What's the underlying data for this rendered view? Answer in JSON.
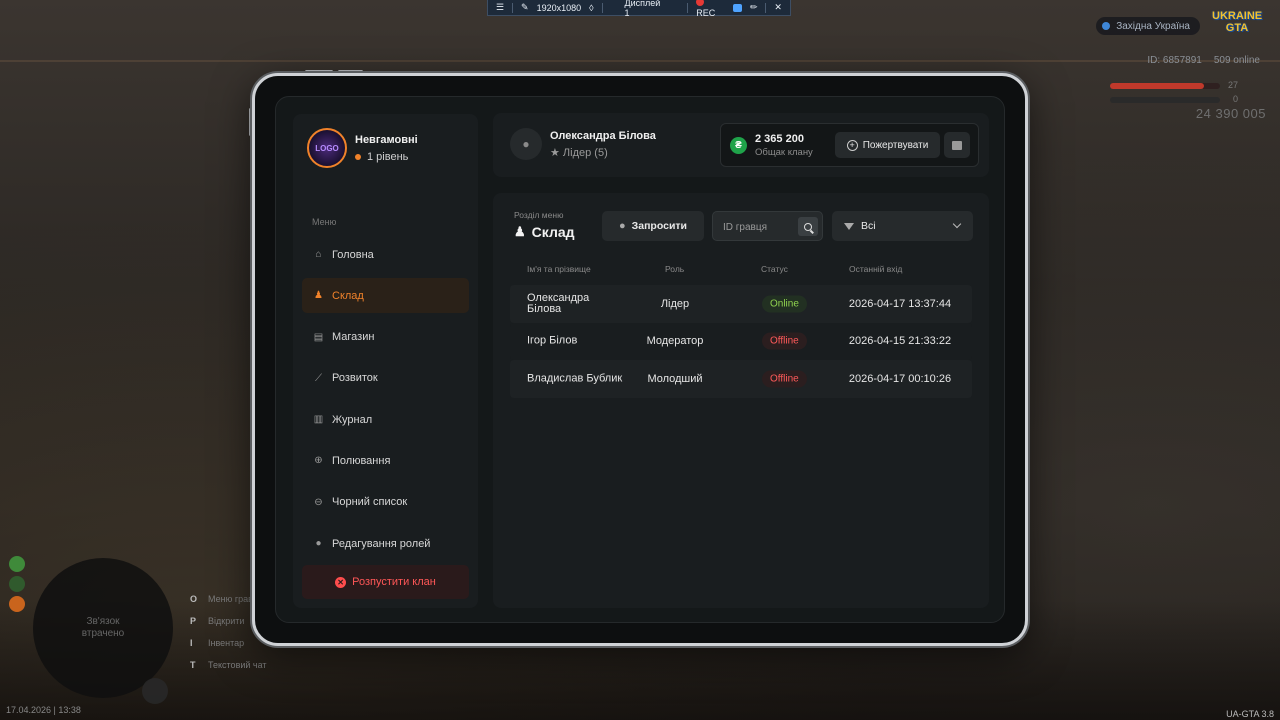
{
  "rec_bar": {
    "resolution": "1920x1080",
    "display": "Дисплей 1",
    "rec": "REC"
  },
  "hud": {
    "region": "Західна Україна",
    "logo": "UKRAINE GTA",
    "player_id": "ID: 6857891",
    "online": "509 online",
    "hp": "27",
    "armor": "0",
    "money": "24 390 005",
    "datetime": "17.04.2026 | 13:38",
    "version": "UA-GTA 3.8",
    "minimap_text": "Зв'язок втрачено",
    "hints": [
      {
        "key": "O",
        "label": "Меню гравця"
      },
      {
        "key": "P",
        "label": "Відкрити"
      },
      {
        "key": "I",
        "label": "Інвентар"
      },
      {
        "key": "T",
        "label": "Текстовий чат"
      }
    ]
  },
  "sidebar": {
    "clan_name": "Невгамовні",
    "clan_level": "1 рівень",
    "avatar_text": "LOGO",
    "menu_label": "Меню",
    "items": [
      {
        "label": "Головна",
        "icon": "home-icon",
        "glyph": "⌂"
      },
      {
        "label": "Склад",
        "icon": "people-icon",
        "glyph": "👥"
      },
      {
        "label": "Магазин",
        "icon": "shop-icon",
        "glyph": "▤"
      },
      {
        "label": "Розвиток",
        "icon": "chart-icon",
        "glyph": "📈"
      },
      {
        "label": "Журнал",
        "icon": "book-icon",
        "glyph": "▥"
      },
      {
        "label": "Полювання",
        "icon": "crosshair-icon",
        "glyph": "⊕"
      },
      {
        "label": "Чорний список",
        "icon": "block-icon",
        "glyph": "⊖"
      },
      {
        "label": "Редагування ролей",
        "icon": "user-edit-icon",
        "glyph": "👤"
      }
    ],
    "disband_label": "Розпустити клан"
  },
  "header": {
    "user_name": "Олександра Білова",
    "user_role": "★ Лідер (5)",
    "bank_amount": "2 365 200",
    "bank_label": "Общак клану",
    "donate_label": "Пожертвувати",
    "currency_glyph": "₴"
  },
  "main": {
    "section_label": "Розділ меню",
    "section_title": "Склад",
    "invite_label": "Запросити",
    "search_placeholder": "ID гравця",
    "filter_value": "Всі",
    "columns": [
      "Ім'я та прізвище",
      "Роль",
      "Статус",
      "Останній вхід"
    ],
    "rows": [
      {
        "name": "Олександра Білова",
        "role": "Лідер",
        "status": "Online",
        "last": "2026-04-17 13:37:44"
      },
      {
        "name": "Ігор Білов",
        "role": "Модератор",
        "status": "Offline",
        "last": "2026-04-15 21:33:22"
      },
      {
        "name": "Владислав Бублик",
        "role": "Молодший",
        "status": "Offline",
        "last": "2026-04-17 00:10:26"
      }
    ]
  },
  "colors": {
    "accent": "#f0822a",
    "online": "#8fd14f",
    "offline": "#ff5a5a",
    "danger": "#ff5757",
    "money": "#1fa34a"
  }
}
